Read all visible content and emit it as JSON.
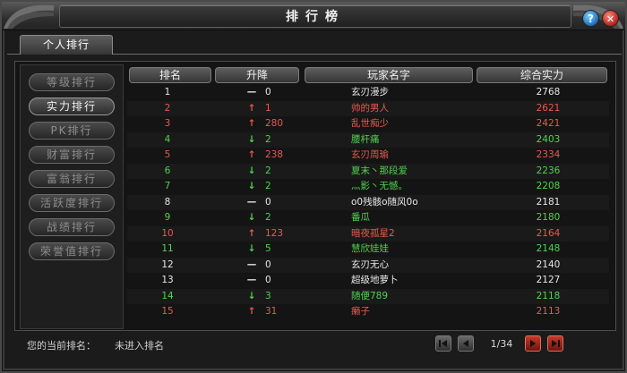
{
  "window": {
    "title": "排行榜"
  },
  "tabs": [
    {
      "label": "个人排行"
    }
  ],
  "sidebar": {
    "items": [
      {
        "label": "等级排行",
        "active": false
      },
      {
        "label": "实力排行",
        "active": true
      },
      {
        "label": "PK排行",
        "active": false
      },
      {
        "label": "财富排行",
        "active": false
      },
      {
        "label": "富翁排行",
        "active": false
      },
      {
        "label": "活跃度排行",
        "active": false
      },
      {
        "label": "战绩排行",
        "active": false
      },
      {
        "label": "荣誉值排行",
        "active": false
      }
    ]
  },
  "table": {
    "headers": {
      "rank": "排名",
      "change": "升降",
      "name": "玩家名字",
      "power": "综合实力"
    },
    "rows": [
      {
        "rank": "1",
        "trend": "same",
        "arrow": "—",
        "change": "0",
        "name": "玄刃漫步",
        "power": "2768",
        "color": "#e6e6e6"
      },
      {
        "rank": "2",
        "trend": "up",
        "arrow": "↑",
        "change": "1",
        "name": "帅的男人",
        "power": "2621",
        "color": "#e65a4f"
      },
      {
        "rank": "3",
        "trend": "up",
        "arrow": "↑",
        "change": "280",
        "name": "乱世痴少",
        "power": "2421",
        "color": "#e65a4f"
      },
      {
        "rank": "4",
        "trend": "down",
        "arrow": "↓",
        "change": "2",
        "name": "腰杆痛",
        "power": "2403",
        "color": "#4fd24f"
      },
      {
        "rank": "5",
        "trend": "up",
        "arrow": "↑",
        "change": "238",
        "name": "玄刃周瑜",
        "power": "2334",
        "color": "#e65a4f"
      },
      {
        "rank": "6",
        "trend": "down",
        "arrow": "↓",
        "change": "2",
        "name": "夏末丶那段爱",
        "power": "2236",
        "color": "#4fd24f"
      },
      {
        "rank": "7",
        "trend": "down",
        "arrow": "↓",
        "change": "2",
        "name": "灬影丶无憾。",
        "power": "2208",
        "color": "#4fd24f"
      },
      {
        "rank": "8",
        "trend": "same",
        "arrow": "—",
        "change": "0",
        "name": "o0残骸o随风0o",
        "power": "2181",
        "color": "#e6e6e6"
      },
      {
        "rank": "9",
        "trend": "down",
        "arrow": "↓",
        "change": "2",
        "name": "番瓜",
        "power": "2180",
        "color": "#4fd24f"
      },
      {
        "rank": "10",
        "trend": "up",
        "arrow": "↑",
        "change": "123",
        "name": "暗夜孤星2",
        "power": "2164",
        "color": "#e65a4f"
      },
      {
        "rank": "11",
        "trend": "down",
        "arrow": "↓",
        "change": "5",
        "name": "慧欣娃娃",
        "power": "2148",
        "color": "#4fd24f"
      },
      {
        "rank": "12",
        "trend": "same",
        "arrow": "—",
        "change": "0",
        "name": "玄刃无心",
        "power": "2140",
        "color": "#e6e6e6"
      },
      {
        "rank": "13",
        "trend": "same",
        "arrow": "—",
        "change": "0",
        "name": "超级地萝卜",
        "power": "2127",
        "color": "#e6e6e6"
      },
      {
        "rank": "14",
        "trend": "down",
        "arrow": "↓",
        "change": "3",
        "name": "随便789",
        "power": "2118",
        "color": "#4fd24f"
      },
      {
        "rank": "15",
        "trend": "up",
        "arrow": "↑",
        "change": "31",
        "name": "癞子",
        "power": "2113",
        "color": "#e65a4f"
      }
    ]
  },
  "footer": {
    "my_rank_label": "您的当前排名：",
    "my_rank_value": "未进入排名",
    "page_indicator": "1/34"
  },
  "icons": {
    "help": "?",
    "close": "✕",
    "first": "first-page-icon",
    "prev": "prev-page-icon",
    "next": "next-page-icon",
    "last": "last-page-icon"
  },
  "colors": {
    "up": "#e65a4f",
    "down": "#4fd24f",
    "same": "#e6e6e6"
  }
}
